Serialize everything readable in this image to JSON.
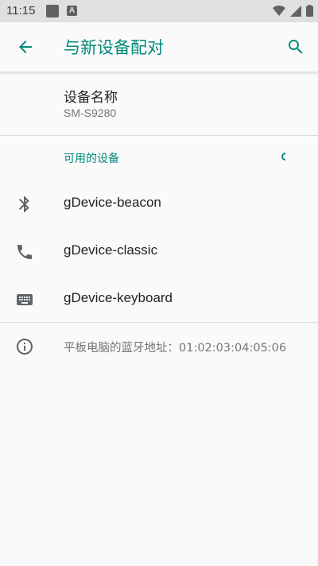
{
  "status_bar": {
    "time": "11:15",
    "icons": [
      "notification-square-icon",
      "a-icon",
      "wifi-icon",
      "signal-icon",
      "battery-icon"
    ],
    "a_icon_text": "A"
  },
  "app_bar": {
    "title": "与新设备配对",
    "accent_color": "#00897b"
  },
  "device_name": {
    "label": "设备名称",
    "value": "SM-S9280"
  },
  "available_devices": {
    "header": "可用的设备",
    "items": [
      {
        "label": "gDevice-beacon",
        "icon": "bluetooth-icon"
      },
      {
        "label": "gDevice-classic",
        "icon": "phone-icon"
      },
      {
        "label": "gDevice-keyboard",
        "icon": "keyboard-icon"
      }
    ]
  },
  "info": {
    "text": "平板电脑的蓝牙地址：01:02:03:04:05:06"
  }
}
